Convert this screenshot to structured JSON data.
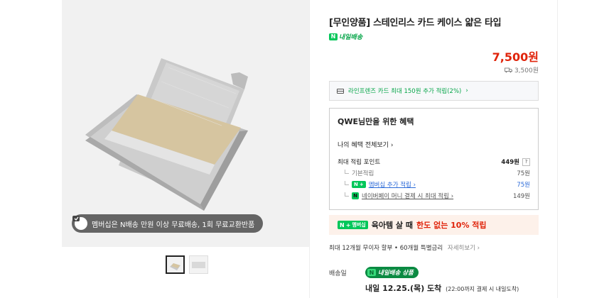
{
  "gallery": {
    "promo_text": "멤버십은 N배송 만원 이상 무료배송, 1회 무료교환반품"
  },
  "product": {
    "title": "[무인양품] 스테인리스 카드 케이스 얇은 타입",
    "delivery_badge": "내일배송",
    "price": "7,500원",
    "shipping_fee": "3,500원"
  },
  "card_benefit": {
    "text": "라인프렌즈 카드 최대 150원 추가 적립(2%)",
    "chevron": "›"
  },
  "benefit_box": {
    "title": "QWE님만을 위한 혜택",
    "view_all": "나의 혜택 전체보기",
    "max_points_label": "최대 적립 포인트",
    "max_points_value": "449원",
    "help": "?",
    "basic_label": "기본적립",
    "basic_value": "75원",
    "membership_badge": "멤버십",
    "membership_label": "멤버십 추가 적립",
    "membership_value": "75원",
    "pay_badge": "N",
    "pay_label": "네이버페이 머니 결제 시 최대 적립",
    "pay_value": "149원"
  },
  "banner": {
    "badge": "멤버십",
    "text": "육아템 살 때",
    "highlight": "한도 없는 10% 적립"
  },
  "installment": {
    "text": "최대 12개월 무이자 할부 • 60개월 특별금리",
    "more": "자세히보기 ›"
  },
  "shipping": {
    "label": "배송일",
    "pill": "내일배송 상품",
    "date": "내일 12.25.(목) 도착",
    "note": "(22:00까지 결제 시 내일도착)"
  },
  "colors": {
    "price": "#e0240b",
    "naver_green": "#03c75a",
    "link_blue": "#2b6ad8",
    "banner_bg": "#fdf1ea"
  }
}
